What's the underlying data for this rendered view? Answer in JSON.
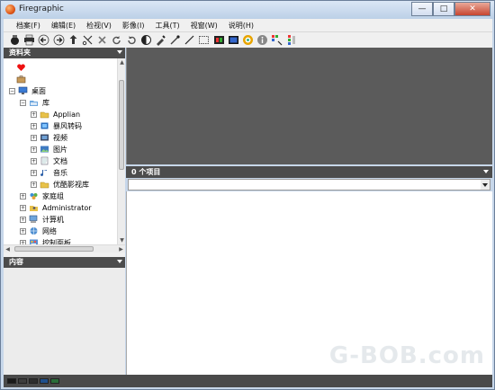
{
  "window": {
    "title": "Firegraphic",
    "controls": [
      "—",
      "□",
      "✕"
    ]
  },
  "menu": [
    {
      "label": "档案(F)",
      "name": "menu-file"
    },
    {
      "label": "编辑(E)",
      "name": "menu-edit"
    },
    {
      "label": "检视(V)",
      "name": "menu-view"
    },
    {
      "label": "影像(I)",
      "name": "menu-image"
    },
    {
      "label": "工具(T)",
      "name": "menu-tools"
    },
    {
      "label": "视窗(W)",
      "name": "menu-window"
    },
    {
      "label": "说明(H)",
      "name": "menu-help"
    }
  ],
  "toolbar": [
    "scanner-icon",
    "print-icon",
    "back-arrow-icon",
    "forward-arrow-icon",
    "up-folder-icon",
    "cut-icon",
    "delete-icon",
    "rotate-left-icon",
    "rotate-right-icon",
    "contrast-icon",
    "pipette-icon",
    "brush-icon",
    "line-icon",
    "select-rect-icon",
    "filmstrip-icon",
    "slideshow-icon",
    "color-wheel-icon",
    "info-icon",
    "palette-cursor-icon",
    "levels-icon"
  ],
  "folders_panel": {
    "title": "资料夹",
    "tree": [
      {
        "label": "",
        "icon": "favorites-heart-icon",
        "depth": 1,
        "expander": ""
      },
      {
        "label": "",
        "icon": "briefcase-icon",
        "depth": 1,
        "expander": ""
      },
      {
        "label": "桌面",
        "icon": "desktop-icon",
        "depth": 0,
        "expander": "−"
      },
      {
        "label": "库",
        "icon": "library-folder-icon",
        "depth": 1,
        "expander": "−"
      },
      {
        "label": "Applian",
        "icon": "folder-icon",
        "depth": 2,
        "expander": "+"
      },
      {
        "label": "暴风转码",
        "icon": "app-icon",
        "depth": 2,
        "expander": "+"
      },
      {
        "label": "视频",
        "icon": "video-library-icon",
        "depth": 2,
        "expander": "+"
      },
      {
        "label": "图片",
        "icon": "pictures-library-icon",
        "depth": 2,
        "expander": "+"
      },
      {
        "label": "文档",
        "icon": "documents-library-icon",
        "depth": 2,
        "expander": "+"
      },
      {
        "label": "音乐",
        "icon": "music-library-icon",
        "depth": 2,
        "expander": "+"
      },
      {
        "label": "优酷影视库",
        "icon": "folder-icon",
        "depth": 2,
        "expander": "+"
      },
      {
        "label": "家庭组",
        "icon": "homegroup-icon",
        "depth": 1,
        "expander": "+"
      },
      {
        "label": "Administrator",
        "icon": "user-folder-icon",
        "depth": 1,
        "expander": "+"
      },
      {
        "label": "计算机",
        "icon": "computer-icon",
        "depth": 1,
        "expander": "+"
      },
      {
        "label": "网络",
        "icon": "network-icon",
        "depth": 1,
        "expander": "+"
      },
      {
        "label": "控制面板",
        "icon": "control-panel-icon",
        "depth": 1,
        "expander": "+"
      }
    ]
  },
  "contents_panel": {
    "title": "内容"
  },
  "items_header": "0 个项目",
  "path_value": "",
  "watermark": "G-BOB.com",
  "colors": {
    "panel_header": "#4c4c4c",
    "preview_bg": "#5b5b5b",
    "status_swatches": [
      "#1a1a1a",
      "#3d3d3d",
      "#2e2e2e",
      "#1e4f8c",
      "#2a6d3a"
    ]
  }
}
